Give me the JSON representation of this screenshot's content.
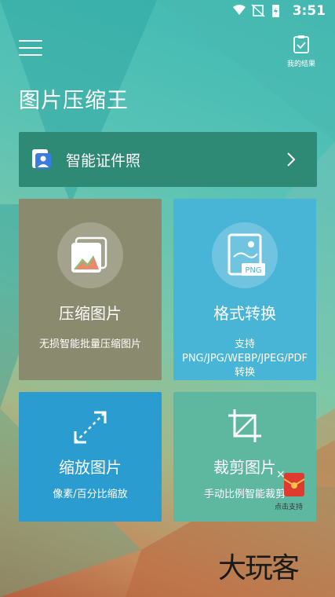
{
  "status": {
    "time": "3:51"
  },
  "header": {
    "results_label": "我的结果",
    "app_title": "图片压缩王"
  },
  "id_photo": {
    "label": "智能证件照"
  },
  "tiles": [
    {
      "title": "压缩图片",
      "desc": "无损智能批量压缩图片"
    },
    {
      "title": "格式转换",
      "desc": "支持PNG/JPG/WEBP/JPEG/PDF转换",
      "badge": "PNG"
    },
    {
      "title": "缩放图片",
      "desc": "像素/百分比缩放"
    },
    {
      "title": "裁剪图片",
      "desc": "手动比例智能裁剪"
    }
  ],
  "ad": {
    "close": "×",
    "label": "点击支持"
  },
  "watermark": "大玩客",
  "colors": {
    "id_bar": "#2e8a74",
    "tile1": "#8a8a6e",
    "tile2": "#48b4d6",
    "tile3": "#2a9cd0",
    "tile4": "#5eb8a0"
  }
}
